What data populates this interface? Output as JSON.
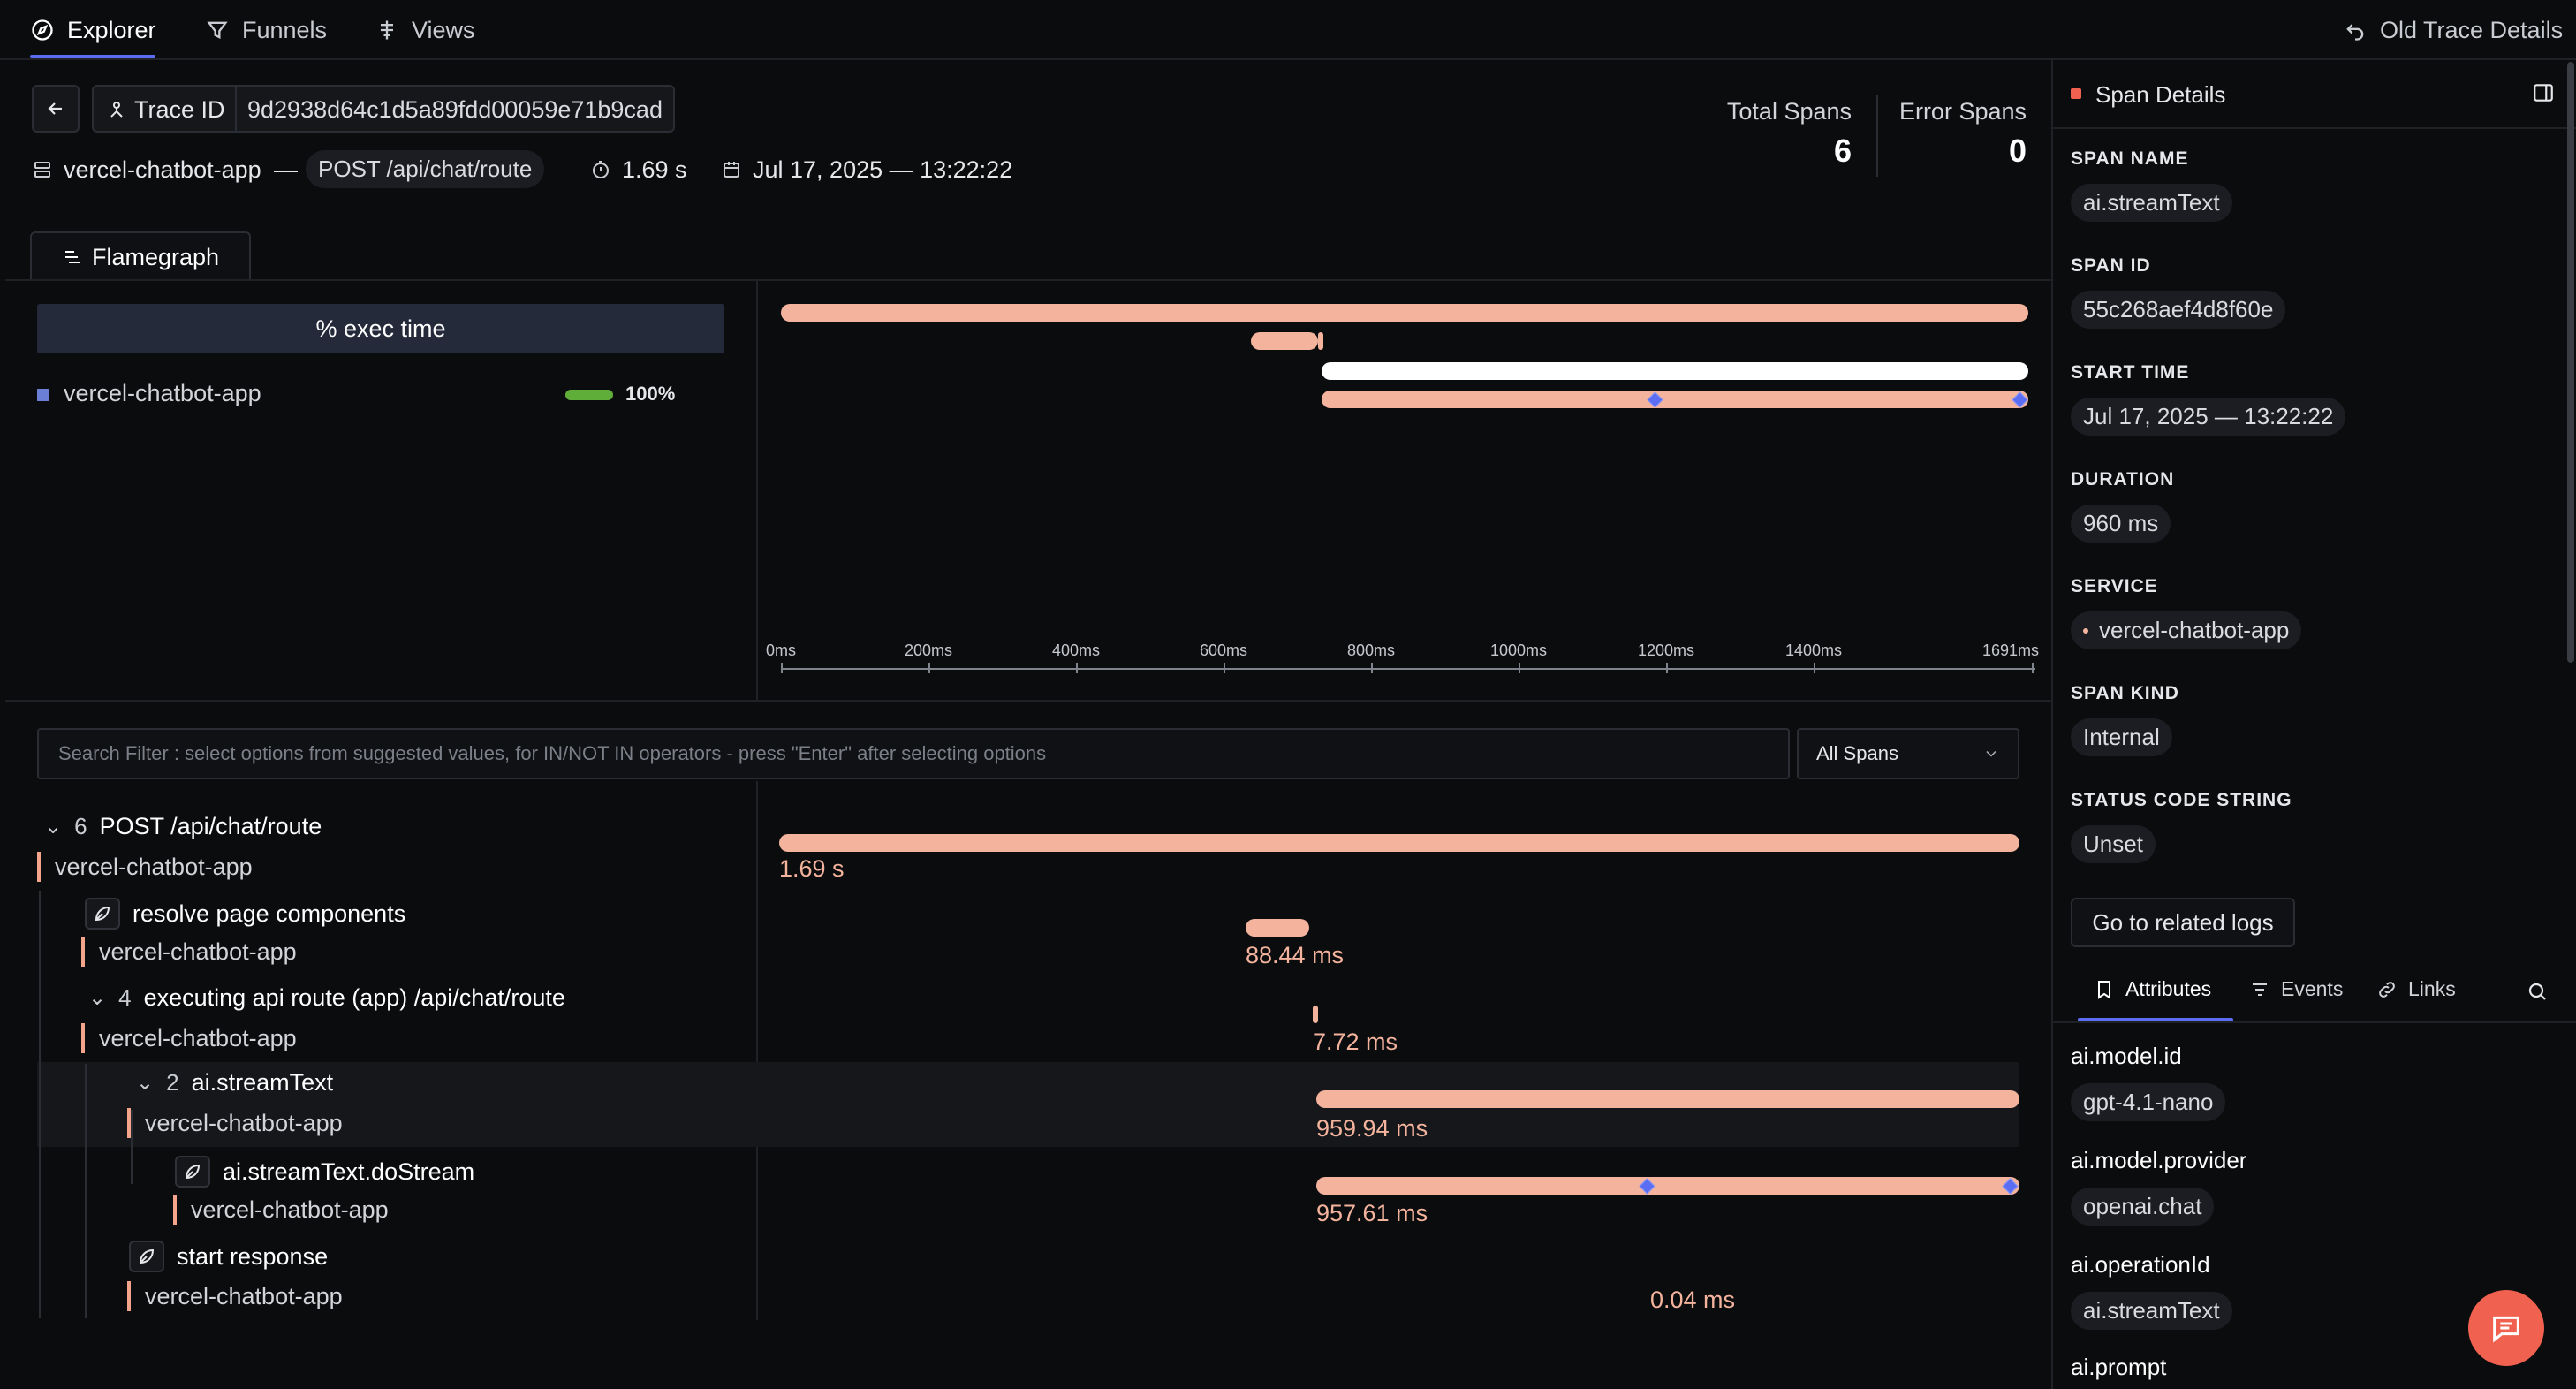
{
  "nav": {
    "tabs": [
      {
        "label": "Explorer",
        "icon": "compass-icon",
        "active": true
      },
      {
        "label": "Funnels",
        "icon": "funnel-icon"
      },
      {
        "label": "Views",
        "icon": "views-icon"
      }
    ],
    "old_trace_label": "Old Trace Details"
  },
  "header": {
    "trace_id_label": "Trace ID",
    "trace_id": "9d2938d64c1d5a89fdd00059e71b9cad",
    "service": "vercel-chatbot-app",
    "separator": "—",
    "route": "POST /api/chat/route",
    "duration": "1.69 s",
    "timestamp": "Jul 17, 2025 — 13:22:22",
    "total_spans_label": "Total Spans",
    "total_spans": "6",
    "error_spans_label": "Error Spans",
    "error_spans": "0"
  },
  "flamegraph": {
    "tab_label": "Flamegraph",
    "exec_header": "% exec time",
    "service": "vercel-chatbot-app",
    "service_pct": "100%",
    "service_fraction": 1.0,
    "axis_ticks": [
      "0ms",
      "200ms",
      "400ms",
      "600ms",
      "800ms",
      "1000ms",
      "1200ms",
      "1400ms",
      "1691ms"
    ]
  },
  "filter": {
    "search_placeholder": "Search Filter : select options from suggested values, for IN/NOT IN operators - press \"Enter\" after selecting options",
    "span_select": "All Spans"
  },
  "spans": [
    {
      "name": "POST /api/chat/route",
      "count": "6",
      "service": "vercel-chatbot-app",
      "duration": "1.69 s"
    },
    {
      "name": "resolve page components",
      "service": "vercel-chatbot-app",
      "duration": "88.44 ms"
    },
    {
      "name": "executing api route (app) /api/chat/route",
      "count": "4",
      "service": "vercel-chatbot-app",
      "duration": "7.72 ms"
    },
    {
      "name": "ai.streamText",
      "count": "2",
      "service": "vercel-chatbot-app",
      "duration": "959.94 ms"
    },
    {
      "name": "ai.streamText.doStream",
      "service": "vercel-chatbot-app",
      "duration": "957.61 ms"
    },
    {
      "name": "start response",
      "service": "vercel-chatbot-app",
      "duration": "0.04 ms"
    }
  ],
  "details": {
    "title": "Span Details",
    "span_name_label": "SPAN NAME",
    "span_name": "ai.streamText",
    "span_id_label": "SPAN ID",
    "span_id": "55c268aef4d8f60e",
    "start_time_label": "START TIME",
    "start_time": "Jul 17, 2025 — 13:22:22",
    "duration_label": "DURATION",
    "duration": "960 ms",
    "service_label": "SERVICE",
    "service": "vercel-chatbot-app",
    "span_kind_label": "SPAN KIND",
    "span_kind": "Internal",
    "status_label": "STATUS CODE STRING",
    "status": "Unset",
    "related_logs": "Go to related logs",
    "tabs": [
      "Attributes",
      "Events",
      "Links"
    ],
    "attributes": [
      {
        "key": "ai.model.id",
        "value": "gpt-4.1-nano"
      },
      {
        "key": "ai.model.provider",
        "value": "openai.chat"
      },
      {
        "key": "ai.operationId",
        "value": "ai.streamText"
      },
      {
        "key": "ai.prompt",
        "value": ""
      }
    ]
  },
  "colors": {
    "accent": "#5b6df2",
    "span_bar": "#f4b39d",
    "fab": "#f0624f",
    "success": "#5fae3a"
  }
}
